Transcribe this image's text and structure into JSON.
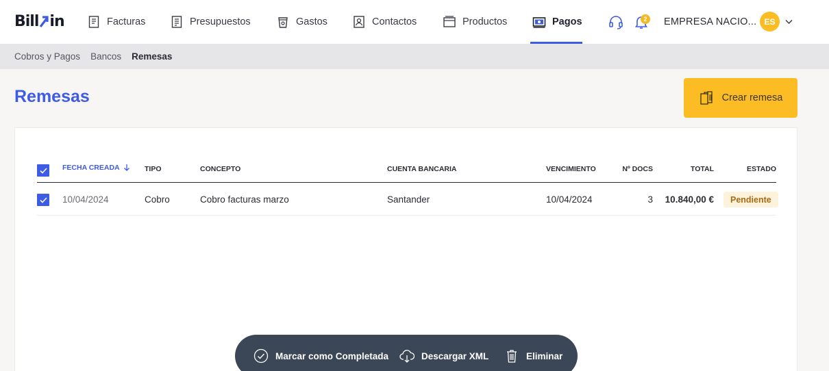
{
  "app": {
    "logo_text_left": "Bill",
    "logo_text_right": "in"
  },
  "nav": {
    "items": [
      {
        "label": "Facturas",
        "icon": "invoice-icon"
      },
      {
        "label": "Presupuestos",
        "icon": "quote-icon"
      },
      {
        "label": "Gastos",
        "icon": "expense-cup-icon"
      },
      {
        "label": "Contactos",
        "icon": "contact-card-icon"
      },
      {
        "label": "Productos",
        "icon": "product-box-icon"
      },
      {
        "label": "Pagos",
        "icon": "payment-bill-icon",
        "active": true
      }
    ],
    "notifications_count": "2",
    "company": "EMPRESA NACIO...",
    "avatar_initials": "ES"
  },
  "breadcrumb": [
    "Cobros y Pagos",
    "Bancos",
    "Remesas"
  ],
  "page": {
    "title": "Remesas",
    "create_button": "Crear remesa"
  },
  "table": {
    "columns": {
      "fecha": "FECHA CREADA",
      "tipo": "TIPO",
      "concepto": "CONCEPTO",
      "cuenta": "CUENTA BANCARIA",
      "vencimiento": "VENCIMIENTO",
      "docs": "Nº DOCS",
      "total": "TOTAL",
      "estado": "ESTADO"
    },
    "sort_column": "fecha",
    "rows": [
      {
        "checked": true,
        "fecha": "10/04/2024",
        "tipo": "Cobro",
        "concepto": "Cobro facturas marzo",
        "cuenta": "Santander",
        "vencimiento": "10/04/2024",
        "docs": "3",
        "total": "10.840,00 €",
        "estado": "Pendiente"
      }
    ]
  },
  "actions": {
    "complete": "Marcar como Completada",
    "download": "Descargar XML",
    "delete": "Eliminar"
  },
  "colors": {
    "accent": "#3d5be4",
    "brand_yellow": "#fbbd23",
    "action_bar": "#3b4656",
    "pending_bg": "#fdf3dc",
    "pending_text": "#a86a10"
  }
}
